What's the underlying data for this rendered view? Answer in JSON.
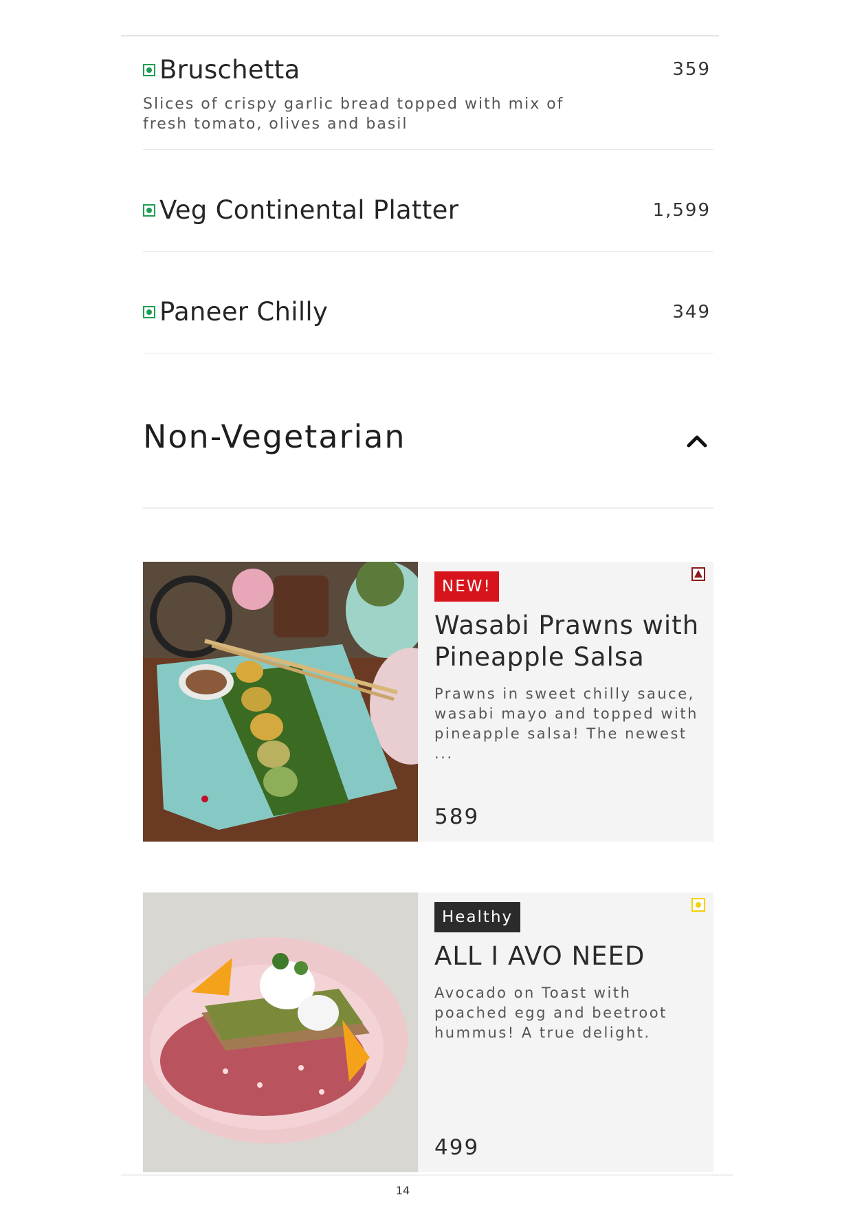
{
  "veg_items": [
    {
      "name": "Bruschetta",
      "price": "359",
      "description": "Slices of crispy garlic bread topped with mix of fresh tomato, olives and basil"
    },
    {
      "name": "Veg Continental Platter",
      "price": "1,599"
    },
    {
      "name": "Paneer Chilly",
      "price": "349"
    }
  ],
  "section": {
    "title": "Non-Vegetarian",
    "collapse_icon": "chevron-up-icon"
  },
  "cards": [
    {
      "badge": "NEW!",
      "badge_color": "#d7141b",
      "title": "Wasabi Prawns with Pineapple Salsa",
      "description": "Prawns in sweet chilly sauce, wasabi mayo and topped with pineapple salsa! The newest ...",
      "price": "589",
      "type_icon": "non-veg-triangle-icon",
      "type_color": "#8b1a1a"
    },
    {
      "badge": "Healthy",
      "badge_color": "#2b2b2b",
      "title": "ALL I AVO NEED",
      "description": "Avocado on Toast with poached egg and beetroot hummus! A true delight.",
      "price": "499",
      "type_icon": "egg-dot-icon",
      "type_color": "#f2d20a"
    }
  ],
  "page_number": "14"
}
